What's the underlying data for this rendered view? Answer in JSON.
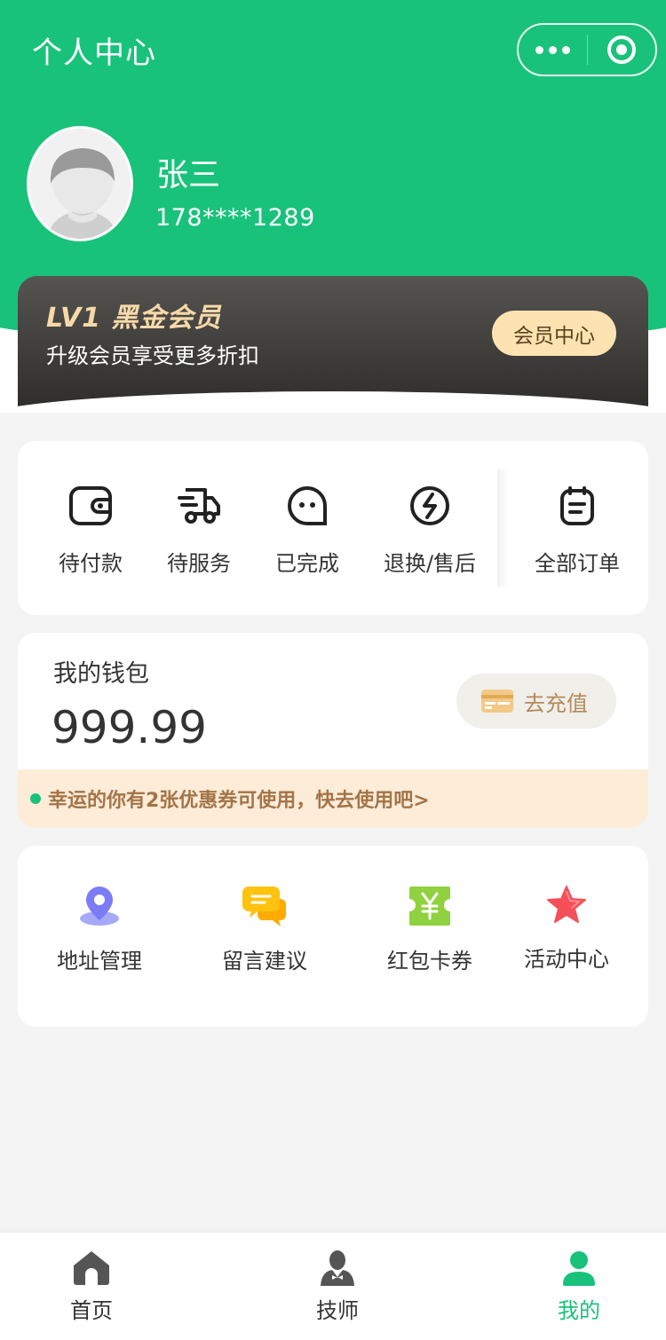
{
  "header": {
    "title": "个人中心",
    "capsule_more_icon": "more-dots-icon",
    "capsule_close_icon": "target-circle-icon"
  },
  "user": {
    "name": "张三",
    "phone": "178****1289",
    "avatar_icon": "default-avatar-icon"
  },
  "vip": {
    "level": "LV1 黑金会员",
    "subtitle": "升级会员享受更多折扣",
    "button_label": "会员中心",
    "colors": {
      "card": "#2e2d2b",
      "title": "#f7d9a9",
      "button": "#fde3b1"
    }
  },
  "orders": {
    "items": [
      {
        "label": "待付款",
        "icon": "wallet-icon"
      },
      {
        "label": "待服务",
        "icon": "delivery-truck-icon"
      },
      {
        "label": "已完成",
        "icon": "smile-face-icon"
      },
      {
        "label": "退换/售后",
        "icon": "exchange-icon"
      },
      {
        "label": "全部订单",
        "icon": "order-list-icon"
      }
    ]
  },
  "wallet": {
    "title": "我的钱包",
    "amount": "999.99",
    "recharge_label": "去充值",
    "recharge_icon": "card-icon",
    "coupon_notice": "幸运的你有2张优惠券可使用，快去使用吧>"
  },
  "services": {
    "items": [
      {
        "label": "地址管理",
        "icon": "location-pin-icon",
        "color": "#7b7cf6"
      },
      {
        "label": "留言建议",
        "icon": "chat-bubbles-icon",
        "color": "#ffc20e"
      },
      {
        "label": "红包卡券",
        "icon": "coupon-yen-icon",
        "color": "#8fd13e"
      },
      {
        "label": "活动中心",
        "icon": "star-icon",
        "color": "#f5505a"
      }
    ]
  },
  "tabbar": {
    "items": [
      {
        "label": "首页",
        "icon": "home-icon",
        "active": false
      },
      {
        "label": "技师",
        "icon": "technician-icon",
        "active": false
      },
      {
        "label": "我的",
        "icon": "user-icon",
        "active": true
      }
    ]
  },
  "colors": {
    "primary_green": "#19c27a",
    "background": "#f4f4f4"
  }
}
